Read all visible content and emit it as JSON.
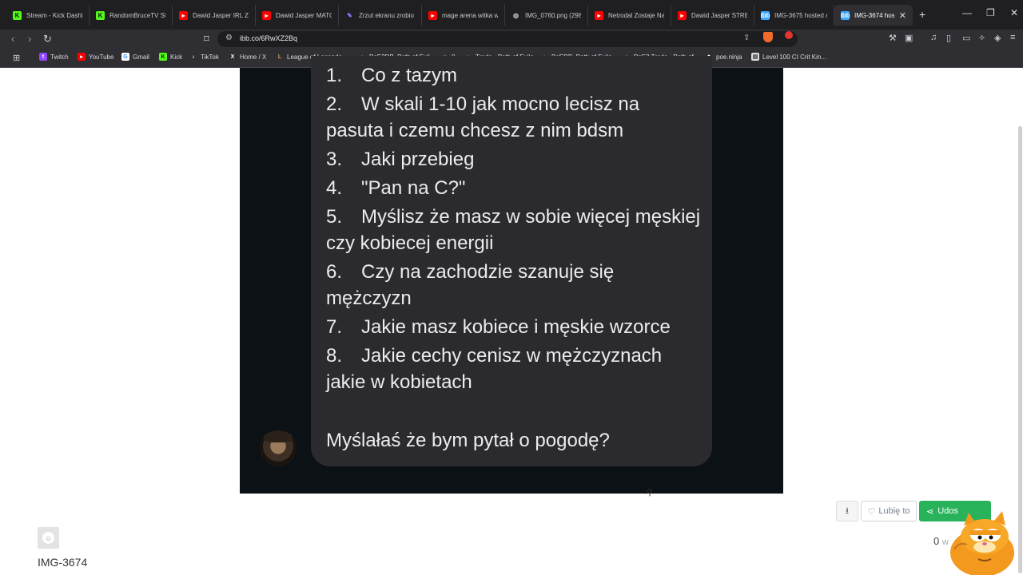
{
  "tabs": [
    {
      "label": "Stream - Kick Dashb",
      "icon": "kick-icon",
      "active": false
    },
    {
      "label": "RandomBruceTV St",
      "icon": "kick-icon",
      "active": false
    },
    {
      "label": "Dawid Jasper IRL Z",
      "icon": "youtube-icon",
      "active": false
    },
    {
      "label": "Dawid Jasper MATC",
      "icon": "youtube-icon",
      "active": false
    },
    {
      "label": "Zrzut ekranu zrobio",
      "icon": "pen-icon",
      "active": false
    },
    {
      "label": "mage arena witka w",
      "icon": "youtube-icon",
      "active": false
    },
    {
      "label": "IMG_0760.png (298",
      "icon": "globe-icon",
      "active": false
    },
    {
      "label": "Netrodal Zostaje Na",
      "icon": "youtube-icon",
      "active": false
    },
    {
      "label": "Dawid Jasper STREA",
      "icon": "youtube-icon",
      "active": false
    },
    {
      "label": "IMG-3675 hosted at",
      "icon": "ibb-icon",
      "active": false
    },
    {
      "label": "IMG-3674 hoste",
      "icon": "ibb-icon",
      "active": true
    }
  ],
  "address": {
    "url": "ibb.co/6RwXZ2Bq"
  },
  "bookmarks": [
    {
      "label": "Twitch",
      "icon": "twitch-icon"
    },
    {
      "label": "YouTube",
      "icon": "youtube-icon"
    },
    {
      "label": "Gmail",
      "icon": "google-icon"
    },
    {
      "label": "Kick",
      "icon": "kick-icon"
    },
    {
      "label": "TikTok",
      "icon": "tiktok-icon"
    },
    {
      "label": "Home / X",
      "icon": "x-icon"
    },
    {
      "label": "League of Legends...",
      "icon": "lol-icon"
    },
    {
      "label": "PoE2DB, Path of Exil...",
      "icon": "poe-icon"
    },
    {
      "label": "0",
      "icon": "folder-icon"
    },
    {
      "label": "Trade - Path of Exile",
      "icon": "poe-icon"
    },
    {
      "label": "PoEDB, Path of Exile...",
      "icon": "poe-icon"
    },
    {
      "label": "PoE2 Trade - Path of...",
      "icon": "poe-icon"
    },
    {
      "label": "poe.ninja",
      "icon": "ninja-icon"
    },
    {
      "label": "Level 100 CI Crit Kin...",
      "icon": "doc-icon"
    }
  ],
  "message": {
    "questions": [
      {
        "num": "1.",
        "text": "Co z tazym"
      },
      {
        "num": "2.",
        "text": "W skali 1-10 jak mocno lecisz na pasuta i czemu chcesz z nim bdsm"
      },
      {
        "num": "3.",
        "text": "Jaki przebieg"
      },
      {
        "num": "4.",
        "text": "\"Pan na C?\""
      },
      {
        "num": "5.",
        "text": "Myślisz że masz w sobie więcej męskiej czy kobiecej energii"
      },
      {
        "num": "6.",
        "text": "Czy na zachodzie szanuje się mężczyzn"
      },
      {
        "num": "7.",
        "text": "Jakie masz kobiece i męskie wzorce"
      },
      {
        "num": "8.",
        "text": "Jakie cechy cenisz w mężczyznach jakie w kobietach"
      }
    ],
    "closing": "Myślałaś że bym pytał o pogodę?"
  },
  "actions": {
    "like_label": "Lubię to",
    "share_label": "Udos"
  },
  "stats": {
    "views": "0",
    "views_unit": "w"
  },
  "image": {
    "title": "IMG-3674"
  },
  "colors": {
    "share": "#28b35b",
    "viewer_bg": "#0c1116",
    "bubble_bg": "#2b2b2f"
  }
}
